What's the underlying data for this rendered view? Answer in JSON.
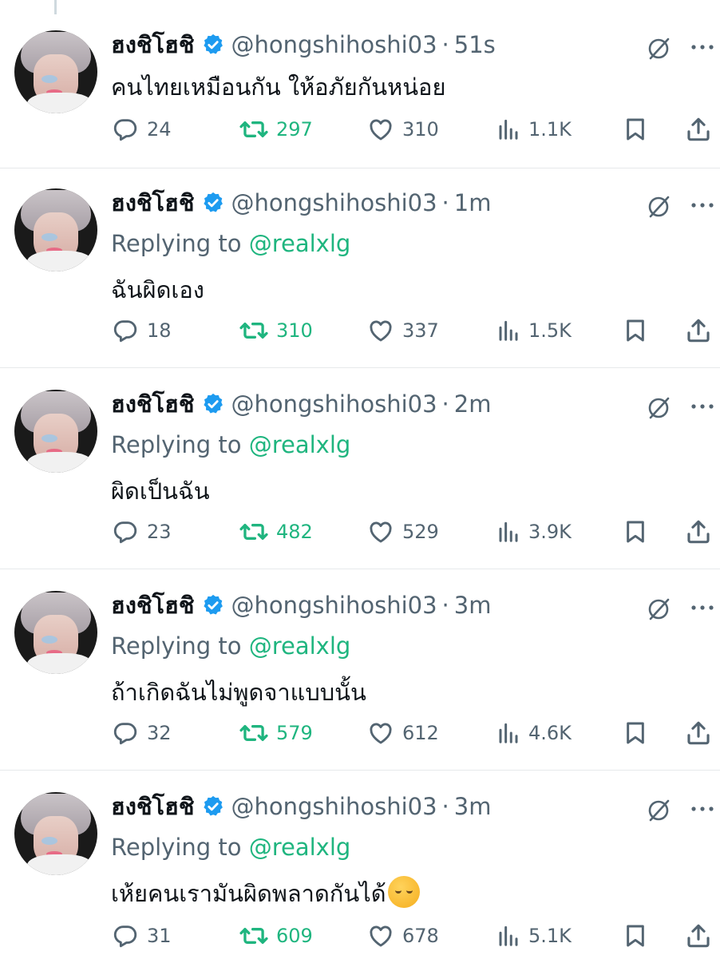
{
  "tweets": [
    {
      "name": "ฮงชิโฮชิ",
      "handle": "@hongshihoshi03",
      "separator": "·",
      "time": "51s",
      "replying_prefix": "",
      "replying_mention": "",
      "text": "คนไทยเหมือนกัน ให้อภัยกันหน่อย",
      "emoji": "",
      "replies": "24",
      "retweets": "297",
      "likes": "310",
      "views": "1.1K"
    },
    {
      "name": "ฮงชิโฮชิ",
      "handle": "@hongshihoshi03",
      "separator": "·",
      "time": "1m",
      "replying_prefix": "Replying to ",
      "replying_mention": "@realxlg",
      "text": "ฉันผิดเอง",
      "emoji": "",
      "replies": "18",
      "retweets": "310",
      "likes": "337",
      "views": "1.5K"
    },
    {
      "name": "ฮงชิโฮชิ",
      "handle": "@hongshihoshi03",
      "separator": "·",
      "time": "2m",
      "replying_prefix": "Replying to ",
      "replying_mention": "@realxlg",
      "text": "ผิดเป็นฉัน",
      "emoji": "",
      "replies": "23",
      "retweets": "482",
      "likes": "529",
      "views": "3.9K"
    },
    {
      "name": "ฮงชิโฮชิ",
      "handle": "@hongshihoshi03",
      "separator": "·",
      "time": "3m",
      "replying_prefix": "Replying to ",
      "replying_mention": "@realxlg",
      "text": "ถ้าเกิดฉันไม่พูดจาแบบนั้น",
      "emoji": "",
      "replies": "32",
      "retweets": "579",
      "likes": "612",
      "views": "4.6K"
    },
    {
      "name": "ฮงชิโฮชิ",
      "handle": "@hongshihoshi03",
      "separator": "·",
      "time": "3m",
      "replying_prefix": "Replying to ",
      "replying_mention": "@realxlg",
      "text": "เห้ยคนเรามันผิดพลาดกันได้",
      "emoji": "pensive-face-emoji",
      "replies": "31",
      "retweets": "609",
      "likes": "678",
      "views": "5.1K"
    }
  ],
  "colors": {
    "accent_green": "#1fb57f",
    "verified_blue": "#1d9bf0",
    "muted": "#536471",
    "text": "#0f1419"
  },
  "icons": [
    "reply-icon",
    "retweet-icon",
    "like-icon",
    "views-icon",
    "bookmark-icon",
    "share-icon",
    "grok-icon",
    "more-icon",
    "verified-badge-icon"
  ]
}
